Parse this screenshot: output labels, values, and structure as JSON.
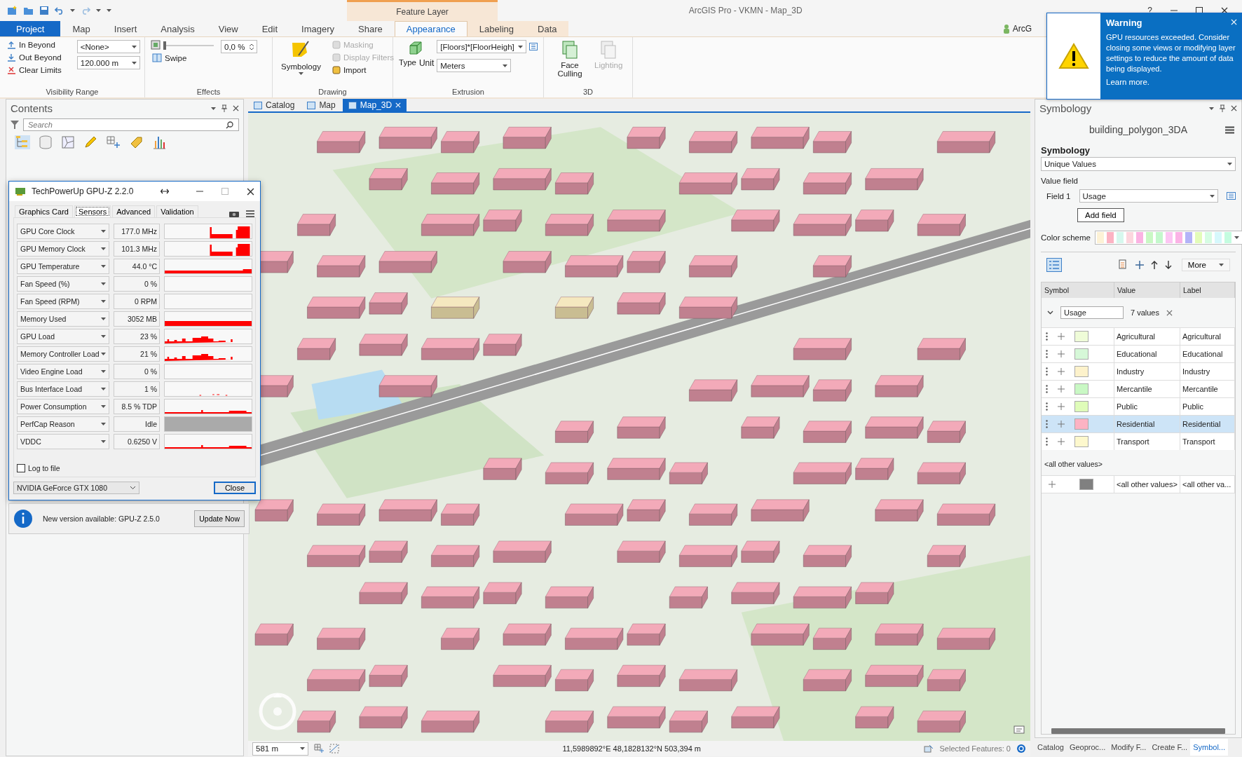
{
  "title_bar": {
    "title": "ArcGIS Pro - VKMN - Map_3D",
    "context_group": "Feature Layer",
    "help": "?"
  },
  "ribbon_tabs": [
    {
      "label": "Project",
      "kind": "backstage",
      "contextual": false,
      "selected": false
    },
    {
      "label": "Map",
      "kind": "tab",
      "contextual": false,
      "selected": false
    },
    {
      "label": "Insert",
      "kind": "tab",
      "contextual": false,
      "selected": false
    },
    {
      "label": "Analysis",
      "kind": "tab",
      "contextual": false,
      "selected": false
    },
    {
      "label": "View",
      "kind": "tab",
      "contextual": false,
      "selected": false
    },
    {
      "label": "Edit",
      "kind": "tab",
      "contextual": false,
      "selected": false
    },
    {
      "label": "Imagery",
      "kind": "tab",
      "contextual": false,
      "selected": false
    },
    {
      "label": "Share",
      "kind": "tab",
      "contextual": false,
      "selected": false
    },
    {
      "label": "Appearance",
      "kind": "tab",
      "contextual": true,
      "selected": true
    },
    {
      "label": "Labeling",
      "kind": "tab",
      "contextual": true,
      "selected": false
    },
    {
      "label": "Data",
      "kind": "tab",
      "contextual": true,
      "selected": false
    }
  ],
  "user": "ArcG",
  "visibility_range": {
    "title": "Visibility Range",
    "in_beyond": "In Beyond",
    "out_beyond": "Out Beyond",
    "clear_limits": "Clear Limits",
    "in_value": "<None>",
    "out_value": "120.000 m"
  },
  "effects": {
    "title": "Effects",
    "level": 0.0,
    "transparency": "0,0 %",
    "swipe": "Swipe"
  },
  "drawing": {
    "title": "Drawing",
    "symbology": "Symbology",
    "items": [
      {
        "label": "Masking",
        "disabled": true
      },
      {
        "label": "Display Filters",
        "disabled": true
      },
      {
        "label": "Import",
        "disabled": false
      }
    ]
  },
  "extrusion": {
    "title": "Extrusion",
    "expression": "[Floors]*[FloorHeigh]",
    "type": "Type",
    "unit_label": "Unit",
    "unit": "Meters"
  },
  "three_d": {
    "title": "3D",
    "buttons": [
      {
        "label": "Face Culling",
        "disabled": false
      },
      {
        "label": "Lighting",
        "disabled": true
      }
    ]
  },
  "warning": {
    "title": "Warning",
    "message": "GPU resources exceeded.  Consider closing some views or modifying layer settings to reduce the amount of data being displayed.",
    "link": "Learn more."
  },
  "contents": {
    "title": "Contents",
    "placeholder": "Search"
  },
  "gpuz": {
    "title": "TechPowerUp GPU-Z 2.2.0",
    "tabs": [
      {
        "label": "Graphics Card",
        "selected": false
      },
      {
        "label": "Sensors",
        "selected": true
      },
      {
        "label": "Advanced",
        "selected": false
      },
      {
        "label": "Validation",
        "selected": false
      }
    ],
    "sensors": [
      {
        "name": "GPU Core Clock",
        "value": "177.0 MHz",
        "kind": "bursts"
      },
      {
        "name": "GPU Memory Clock",
        "value": "101.3 MHz",
        "kind": "bursts"
      },
      {
        "name": "GPU Temperature",
        "value": "44.0 °C",
        "kind": "line"
      },
      {
        "name": "Fan Speed (%)",
        "value": "0 %",
        "kind": "empty"
      },
      {
        "name": "Fan Speed (RPM)",
        "value": "0 RPM",
        "kind": "empty"
      },
      {
        "name": "Memory Used",
        "value": "3052 MB",
        "kind": "bar"
      },
      {
        "name": "GPU Load",
        "value": "23 %",
        "kind": "noise"
      },
      {
        "name": "Memory Controller Load",
        "value": "21 %",
        "kind": "noise"
      },
      {
        "name": "Video Engine Load",
        "value": "0 %",
        "kind": "empty"
      },
      {
        "name": "Bus Interface Load",
        "value": "1 %",
        "kind": "dots"
      },
      {
        "name": "Power Consumption",
        "value": "8.5 % TDP",
        "kind": "low"
      },
      {
        "name": "PerfCap Reason",
        "value": "Idle",
        "kind": "idle"
      },
      {
        "name": "VDDC",
        "value": "0.6250 V",
        "kind": "low"
      }
    ],
    "log_to_file": {
      "label": "Log to file",
      "checked": false
    },
    "gpu": "NVIDIA GeForce GTX 1080",
    "close": "Close",
    "update": {
      "message": "New version available: GPU-Z 2.5.0",
      "button": "Update Now"
    }
  },
  "map_tabs": [
    {
      "label": "Catalog",
      "selected": false
    },
    {
      "label": "Map",
      "selected": false
    },
    {
      "label": "Map_3D",
      "selected": true
    }
  ],
  "status_bar": {
    "scale": "581 m",
    "coordinates": "11,5989892°E 48,1828132°N   503,394 m",
    "selected_features": "Selected Features: 0"
  },
  "symbology": {
    "title": "Symbology",
    "layer": "building_polygon_3DA",
    "heading": "Symbology",
    "method": "Unique Values",
    "value_field": "Value field",
    "field_label": "Field 1",
    "field": "Usage",
    "add_field": "Add field",
    "color_scheme_label": "Color scheme",
    "more": "More",
    "columns": [
      "Symbol",
      "Value",
      "Label"
    ],
    "group": {
      "field": "Usage",
      "count": "7 values"
    },
    "classes": [
      {
        "value": "Agricultural",
        "label": "Agricultural",
        "color": "#effcd8",
        "selected": false
      },
      {
        "value": "Educational",
        "label": "Educational",
        "color": "#d6f8d8",
        "selected": false
      },
      {
        "value": "Industry",
        "label": "Industry",
        "color": "#fdf2cb",
        "selected": false
      },
      {
        "value": "Mercantile",
        "label": "Mercantile",
        "color": "#c9f8c4",
        "selected": false
      },
      {
        "value": "Public",
        "label": "Public",
        "color": "#dffcb9",
        "selected": false
      },
      {
        "value": "Residential",
        "label": "Residential",
        "color": "#fcb3c3",
        "selected": true
      },
      {
        "value": "Transport",
        "label": "Transport",
        "color": "#fdf8cd",
        "selected": false
      }
    ],
    "other_heading": "<all other values>",
    "other": {
      "value": "<all other values>",
      "label": "<all other va...",
      "color": "#808080"
    }
  },
  "bottom_tabs": [
    {
      "label": "Catalog",
      "selected": false
    },
    {
      "label": "Geoproc...",
      "selected": false
    },
    {
      "label": "Modify F...",
      "selected": false
    },
    {
      "label": "Create F...",
      "selected": false
    },
    {
      "label": "Symbol...",
      "selected": true
    }
  ]
}
